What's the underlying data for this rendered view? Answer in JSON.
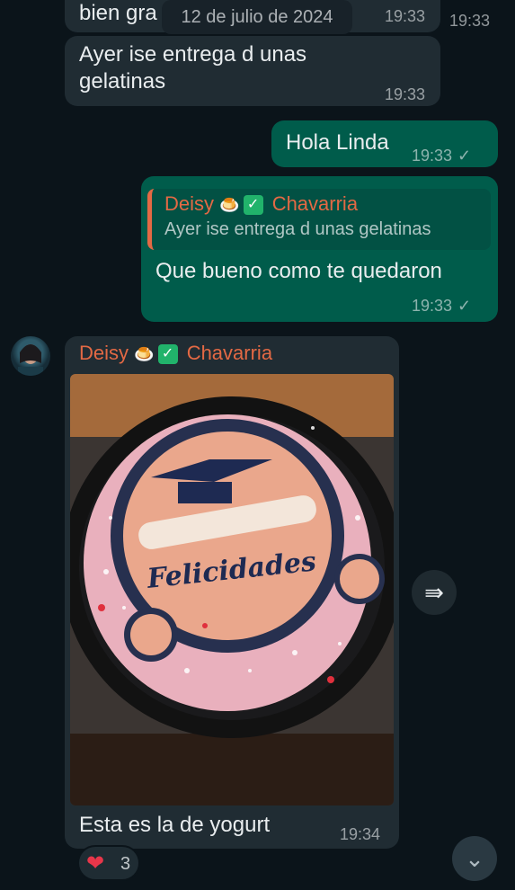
{
  "date_separator": "12 de julio de 2024",
  "messages": [
    {
      "text_partial": "bien gra",
      "time": "19:33"
    },
    {
      "text": "Ayer ise entrega d unas gelatinas",
      "line1": "Ayer ise entrega d unas",
      "line2": "gelatinas",
      "time": "19:33"
    },
    {
      "text": "Hola Linda",
      "time": "19:33"
    },
    {
      "reply_sender": "Deisy",
      "reply_sender_last": "Chavarria",
      "reply_text": "Ayer ise entrega d unas gelatinas",
      "text": "Que bueno como te quedaron",
      "time": "19:33"
    },
    {
      "sender": "Deisy",
      "sender_last": "Chavarria",
      "caption": "Esta es la de yogurt",
      "time": "19:34",
      "photo_text": "Felicidades"
    }
  ],
  "reaction": {
    "emoji": "❤",
    "count": "3"
  },
  "icons": {
    "forward": "forward-icon",
    "scroll_down": "double-chevron-down-icon",
    "check": "check-icon"
  },
  "colors": {
    "background": "#0b141a",
    "incoming": "#202c33",
    "outgoing": "#005c4b",
    "sender_name": "#e36944"
  }
}
